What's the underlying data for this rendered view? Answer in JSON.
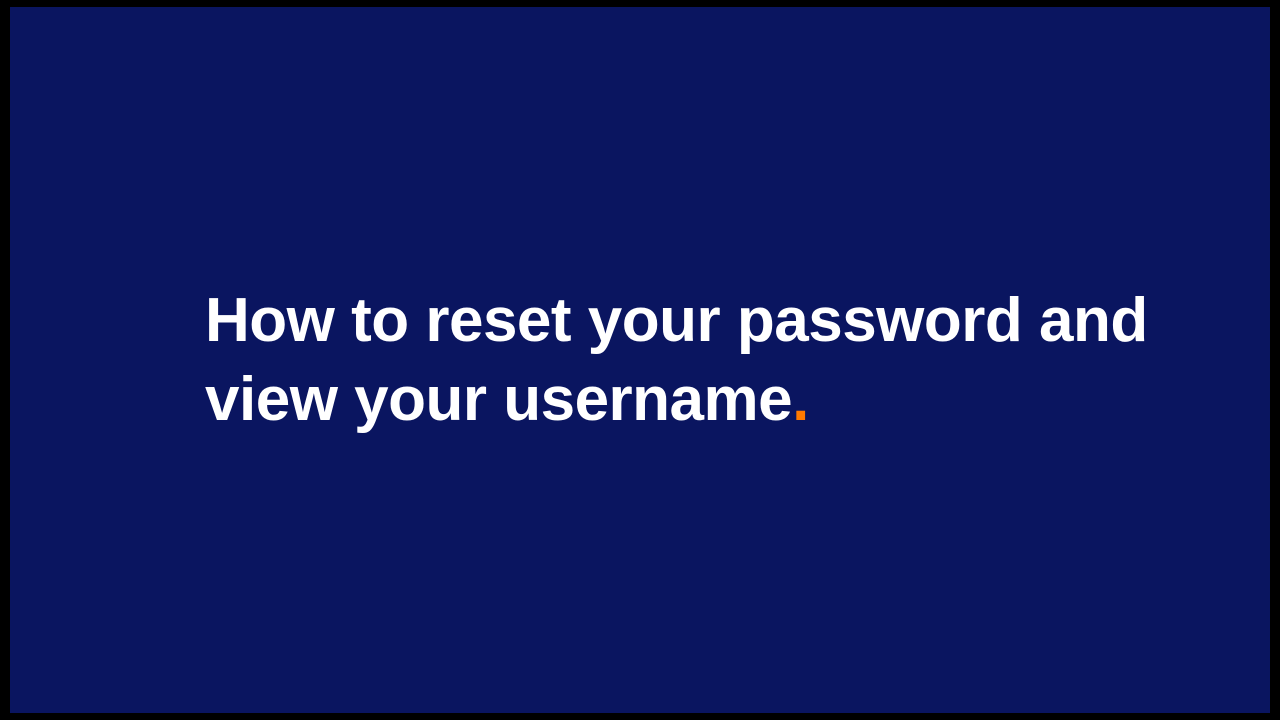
{
  "slide": {
    "title_text": "How to reset your password and view your username",
    "punctuation": ".",
    "colors": {
      "background": "#0a1560",
      "text": "#ffffff",
      "accent": "#ff7a00"
    }
  }
}
